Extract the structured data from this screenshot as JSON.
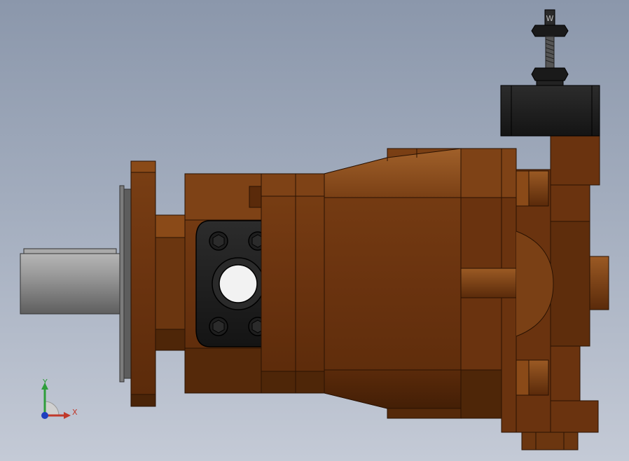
{
  "viewport": {
    "name": "cad-3d-viewport",
    "background_top": "#8b97ab",
    "background_bottom": "#c4cad6"
  },
  "model": {
    "kind": "axial piston pump",
    "body_color": "#6b3610",
    "body_highlight": "#9b5a24",
    "body_shadow": "#4a2408",
    "shaft_color": "#8c8c8c",
    "flange_plate_color": "#1b1b1b",
    "control_block_color": "#222222"
  },
  "triad": {
    "x_label": "X",
    "y_label": "Y",
    "x_color": "#c0392b",
    "y_color": "#2e9e3b",
    "z_color": "#1f3fbf"
  }
}
